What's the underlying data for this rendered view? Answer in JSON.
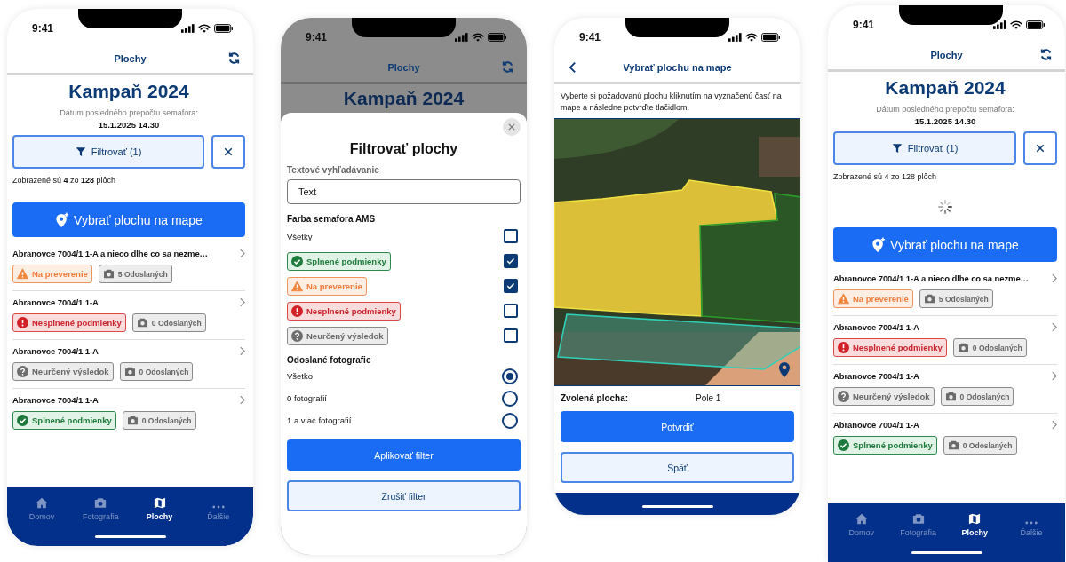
{
  "phones": [
    {
      "kind": "list",
      "status_time": "9:41",
      "title": "Plochy",
      "campaign": "Kampaň 2024",
      "recalc_label": "Dátum posledného prepočtu semafora:",
      "recalc_date": "15.1.2025 14.30",
      "filter_button": "Filtrovať (1)",
      "count": "Zobrazené sú **4** zo **128** plôch",
      "loading": false,
      "map_button": "Vybrať plochu na mape",
      "items": [
        {
          "name": "Abranovce 7004/1 1-A a nieco dlhe co sa nezme…",
          "badge": {
            "kind": "warning",
            "label": "Na preverenie"
          },
          "photos": "5 Odoslaných"
        },
        {
          "name": "Abranovce 7004/1 1-A",
          "badge": {
            "kind": "error",
            "label": "Nesplnené podmienky"
          },
          "photos": "0 Odoslaných"
        },
        {
          "name": "Abranovce 7004/1 1-A",
          "badge": {
            "kind": "unknown",
            "label": "Neurčený výsledok"
          },
          "photos": "0 Odoslaných"
        },
        {
          "name": "Abranovce 7004/1 1-A",
          "badge": {
            "kind": "ok",
            "label": "Splnené podmienky"
          },
          "photos": "0 Odoslaných"
        }
      ],
      "tabs": [
        {
          "label": "Domov",
          "selected": false
        },
        {
          "label": "Fotografia",
          "selected": false
        },
        {
          "label": "Plochy",
          "selected": true
        },
        {
          "label": "Ďalšie",
          "selected": false
        }
      ]
    },
    {
      "kind": "filter",
      "status_time": "9:41",
      "title": "Plochy",
      "campaign": "Kampaň 2024",
      "sheet": {
        "title": "Filtrovať plochy",
        "search_label": "Textové vyhľadávanie",
        "search_value": "Text",
        "color_label": "Farba semafora AMS",
        "color_options": [
          {
            "kind": "plain",
            "label": "Všetky",
            "checked": false
          },
          {
            "kind": "ok",
            "label": "Splnené podmienky",
            "checked": true
          },
          {
            "kind": "warning",
            "label": "Na preverenie",
            "checked": true
          },
          {
            "kind": "error",
            "label": "Nesplnené podmienky",
            "checked": false
          },
          {
            "kind": "unknown",
            "label": "Neurčený výsledok",
            "checked": false
          }
        ],
        "photos_label": "Odoslané fotografie",
        "photo_options": [
          {
            "label": "Všetko",
            "selected": true
          },
          {
            "label": "0 fotografií",
            "selected": false
          },
          {
            "label": "1 a viac fotografií",
            "selected": false
          }
        ],
        "apply": "Aplikovať filter",
        "cancel": "Zrušiť filter"
      }
    },
    {
      "kind": "map",
      "status_time": "9:41",
      "title": "Vybrať plochu na mape",
      "instructions": "Vyberte si požadovanú plochu kliknutím na vyznačenú časť na mape a následne potvrďte tlačidlom.",
      "selected_label": "Zvolená plocha:",
      "selected_value": "Pole 1",
      "confirm": "Potvrdiť",
      "back": "Späť"
    },
    {
      "kind": "list",
      "status_time": "9:41",
      "title": "Plochy",
      "campaign": "Kampaň 2024",
      "recalc_label": "Dátum posledného prepočtu semafora:",
      "recalc_date": "15.1.2025 14.30",
      "filter_button": "Filtrovať (1)",
      "count": "Zobrazené sú 4 zo 128 plôch",
      "loading": true,
      "map_button": "Vybrať plochu na mape",
      "items": [
        {
          "name": "Abranovce 7004/1 1-A a nieco dlhe co sa nezme…",
          "badge": {
            "kind": "warning",
            "label": "Na preverenie"
          },
          "photos": "5 Odoslaných"
        },
        {
          "name": "Abranovce 7004/1 1-A",
          "badge": {
            "kind": "error",
            "label": "Nesplnené podmienky"
          },
          "photos": "0 Odoslaných"
        },
        {
          "name": "Abranovce 7004/1 1-A",
          "badge": {
            "kind": "unknown",
            "label": "Neurčený výsledok"
          },
          "photos": "0 Odoslaných"
        },
        {
          "name": "Abranovce 7004/1 1-A",
          "badge": {
            "kind": "ok",
            "label": "Splnené podmienky"
          },
          "photos": "0 Odoslaných"
        }
      ],
      "tabs": [
        {
          "label": "Domov",
          "selected": false
        },
        {
          "label": "Fotografia",
          "selected": false
        },
        {
          "label": "Plochy",
          "selected": true
        },
        {
          "label": "Ďalšie",
          "selected": false
        }
      ]
    }
  ]
}
